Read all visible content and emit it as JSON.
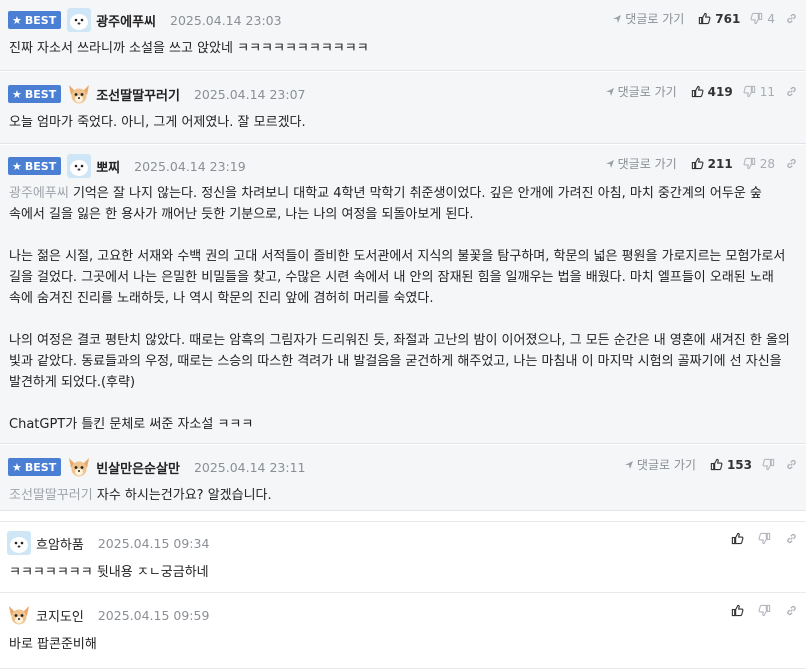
{
  "labels": {
    "best": "BEST",
    "reply": "댓글로 가기"
  },
  "comments": [
    {
      "best": true,
      "avatar": "seal-avatar-icon",
      "nick": "광주에푸씨",
      "date": "2025.04.14 23:03",
      "up": "761",
      "down": "4",
      "mention": "",
      "text": "진짜 자소서 쓰라니까 소설을 쓰고 앉았네 ㅋㅋㅋㅋㅋㅋㅋㅋㅋㅋㅋ"
    },
    {
      "best": true,
      "avatar": "chihuahua-avatar-icon",
      "nick": "조선딸딸꾸러기",
      "date": "2025.04.14 23:07",
      "up": "419",
      "down": "11",
      "mention": "",
      "text": "오늘 엄마가 죽었다. 아니, 그게 어제였나. 잘 모르겠다."
    },
    {
      "best": true,
      "avatar": "seal-avatar-icon",
      "nick": "뽀찌",
      "date": "2025.04.14 23:19",
      "up": "211",
      "down": "28",
      "mention": "광주에푸씨",
      "paragraphs": [
        "기억은 잘 나지 않는다. 정신을 차려보니 대학교 4학년 막학기 취준생이었다. 깊은 안개에 가려진 아침, 마치 중간계의 어두운 숲 속에서 길을 잃은 한 용사가 깨어난 듯한 기분으로, 나는 나의 여정을 되돌아보게 된다.",
        "나는 젊은 시절, 고요한 서재와 수백 권의 고대 서적들이 즐비한 도서관에서 지식의 불꽃을 탐구하며, 학문의 넓은 평원을 가로지르는 모험가로서 길을 걸었다. 그곳에서 나는 은밀한 비밀들을 찾고, 수많은 시련 속에서 내 안의 잠재된 힘을 일깨우는 법을 배웠다. 마치 엘프들이 오래된 노래 속에 숨겨진 진리를 노래하듯, 나 역시 학문의 진리 앞에 겸허히 머리를 숙였다.",
        "나의 여정은 결코 평탄치 않았다. 때로는 암흑의 그림자가 드리워진 듯, 좌절과 고난의 밤이 이어졌으나, 그 모든 순간은 내 영혼에 새겨진 한 올의 빛과 같았다. 동료들과의 우정, 때로는 스승의 따스한 격려가 내 발걸음을 굳건하게 해주었고, 나는 마침내 이 마지막 시험의 골짜기에 선 자신을 발견하게 되었다.(후략)",
        "ChatGPT가 틀킨 문체로 써준 자소설 ㅋㅋㅋ"
      ]
    },
    {
      "best": true,
      "avatar": "chihuahua-avatar-icon",
      "nick": "빈살만은순살만",
      "date": "2025.04.14 23:11",
      "up": "153",
      "down": "",
      "mention": "조선딸딸꾸러기",
      "text": "자수 하시는건가요? 알겠습니다."
    },
    {
      "best": false,
      "avatar": "seal-avatar-icon",
      "nick": "흐암하품",
      "date": "2025.04.15 09:34",
      "up": "",
      "down": "",
      "mention": "",
      "text": "ㅋㅋㅋㅋㅋㅋㅋ 뒷내용 ㅈㄴ궁금하네"
    },
    {
      "best": false,
      "avatar": "chihuahua-avatar-icon",
      "nick": "코지도인",
      "date": "2025.04.15 09:59",
      "up": "",
      "down": "",
      "mention": "",
      "text": "바로 팝콘준비해"
    }
  ]
}
